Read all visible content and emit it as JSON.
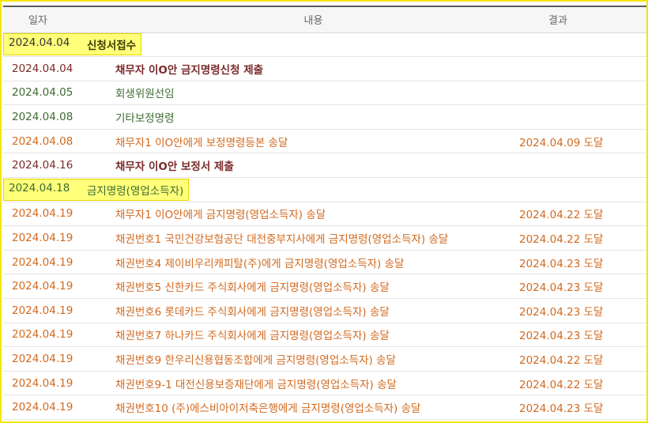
{
  "header": {
    "date": "일자",
    "content": "내용",
    "result": "결과"
  },
  "colors": {
    "orange": "#d2691e",
    "maroon": "#7a2a2a",
    "green": "#3d6b2f",
    "highlight": "#ffff7a"
  },
  "rows": [
    {
      "date": "2024.04.04",
      "content": "신청서접수",
      "result": "",
      "color": "#3d3d00",
      "bold": true,
      "highlight": "date_content"
    },
    {
      "date": "2024.04.04",
      "content": "채무자 이O안 금지명령신청 제출",
      "result": "",
      "color": "#7a2a2a",
      "bold": true,
      "highlight": ""
    },
    {
      "date": "2024.04.05",
      "content": "회생위원선임",
      "result": "",
      "color": "#3d6b2f",
      "bold": false,
      "highlight": ""
    },
    {
      "date": "2024.04.08",
      "content": "기타보정명령",
      "result": "",
      "color": "#3d6b2f",
      "bold": false,
      "highlight": ""
    },
    {
      "date": "2024.04.08",
      "content": "채무자1 이O안에게 보정명령등본 송달",
      "result": "2024.04.09 도달",
      "color": "#d2691e",
      "bold": false,
      "highlight": ""
    },
    {
      "date": "2024.04.16",
      "content": "채무자 이O안 보정서 제출",
      "result": "",
      "color": "#7a2a2a",
      "bold": true,
      "highlight": ""
    },
    {
      "date": "2024.04.18",
      "content": "금지명령(영업소득자)",
      "result": "",
      "color": "#3d6b2f",
      "bold": false,
      "highlight": "date_content"
    },
    {
      "date": "2024.04.19",
      "content": "채무자1 이O안에게 금지명령(영업소득자) 송달",
      "result": "2024.04.22 도달",
      "color": "#d2691e",
      "bold": false,
      "highlight": ""
    },
    {
      "date": "2024.04.19",
      "content": "채권번호1 국민건강보험공단 대전중부지사에게 금지명령(영업소득자) 송달",
      "result": "2024.04.22 도달",
      "color": "#d2691e",
      "bold": false,
      "highlight": ""
    },
    {
      "date": "2024.04.19",
      "content": "채권번호4 제이비우리캐피탈(주)에게 금지명령(영업소득자) 송달",
      "result": "2024.04.23 도달",
      "color": "#d2691e",
      "bold": false,
      "highlight": ""
    },
    {
      "date": "2024.04.19",
      "content": "채권번호5 신한카드 주식회사에게 금지명령(영업소득자) 송달",
      "result": "2024.04.23 도달",
      "color": "#d2691e",
      "bold": false,
      "highlight": ""
    },
    {
      "date": "2024.04.19",
      "content": "채권번호6 롯데카드 주식회사에게 금지명령(영업소득자) 송달",
      "result": "2024.04.23 도달",
      "color": "#d2691e",
      "bold": false,
      "highlight": ""
    },
    {
      "date": "2024.04.19",
      "content": "채권번호7 하나카드 주식회사에게 금지명령(영업소득자) 송달",
      "result": "2024.04.23 도달",
      "color": "#d2691e",
      "bold": false,
      "highlight": ""
    },
    {
      "date": "2024.04.19",
      "content": "채권번호9 한우리신용협동조합에게 금지명령(영업소득자) 송달",
      "result": "2024.04.22 도달",
      "color": "#d2691e",
      "bold": false,
      "highlight": ""
    },
    {
      "date": "2024.04.19",
      "content": "채권번호9-1 대전신용보증재단에게 금지명령(영업소득자) 송달",
      "result": "2024.04.22 도달",
      "color": "#d2691e",
      "bold": false,
      "highlight": ""
    },
    {
      "date": "2024.04.19",
      "content": "채권번호10 (주)에스비아이저축은행에게 금지명령(영업소득자) 송달",
      "result": "2024.04.23 도달",
      "color": "#d2691e",
      "bold": false,
      "highlight": ""
    }
  ]
}
